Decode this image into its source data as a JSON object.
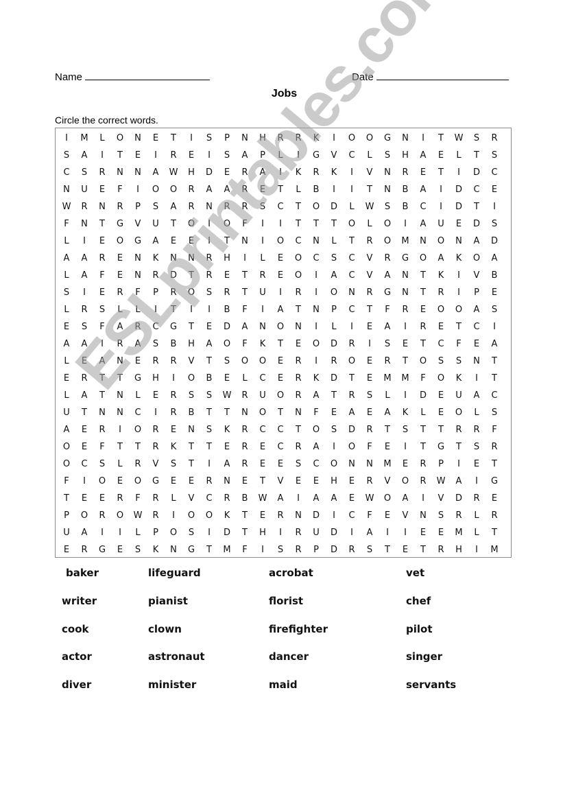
{
  "header": {
    "name_label": "Name",
    "date_label": "Date",
    "title": "Jobs",
    "instructions": "Circle the correct words."
  },
  "grid": [
    [
      "I",
      "M",
      "L",
      "O",
      "N",
      "E",
      "T",
      "I",
      "S",
      "P",
      "N",
      "H",
      "R",
      "R",
      "K",
      "I",
      "O",
      "O",
      "G",
      "N",
      "I",
      "T",
      "W",
      "S",
      "R"
    ],
    [
      "S",
      "A",
      "I",
      "T",
      "E",
      "I",
      "R",
      "E",
      "I",
      "S",
      "A",
      "P",
      "L",
      "I",
      "G",
      "V",
      "C",
      "L",
      "S",
      "H",
      "A",
      "E",
      "L",
      "T",
      "S"
    ],
    [
      "C",
      "S",
      "R",
      "N",
      "N",
      "A",
      "W",
      "H",
      "D",
      "E",
      "R",
      "A",
      "I",
      "K",
      "R",
      "K",
      "I",
      "V",
      "N",
      "R",
      "E",
      "T",
      "I",
      "D",
      "C"
    ],
    [
      "N",
      "U",
      "E",
      "F",
      "I",
      "O",
      "O",
      "R",
      "A",
      "A",
      "R",
      "E",
      "T",
      "L",
      "B",
      "I",
      "I",
      "T",
      "N",
      "B",
      "A",
      "I",
      "D",
      "C",
      "E"
    ],
    [
      "W",
      "R",
      "N",
      "R",
      "P",
      "S",
      "A",
      "R",
      "N",
      "R",
      "R",
      "S",
      "C",
      "T",
      "O",
      "D",
      "L",
      "W",
      "S",
      "B",
      "C",
      "I",
      "D",
      "T",
      "I"
    ],
    [
      "F",
      "N",
      "T",
      "G",
      "V",
      "U",
      "T",
      "O",
      "I",
      "O",
      "F",
      "I",
      "I",
      "T",
      "T",
      "T",
      "O",
      "L",
      "O",
      "I",
      "A",
      "U",
      "E",
      "D",
      "S"
    ],
    [
      "L",
      "I",
      "E",
      "O",
      "G",
      "A",
      "E",
      "E",
      "I",
      "T",
      "N",
      "I",
      "O",
      "C",
      "N",
      "L",
      "T",
      "R",
      "O",
      "M",
      "N",
      "O",
      "N",
      "A",
      "D"
    ],
    [
      "A",
      "A",
      "R",
      "E",
      "N",
      "K",
      "N",
      "N",
      "R",
      "H",
      "I",
      "L",
      "E",
      "O",
      "C",
      "S",
      "C",
      "V",
      "R",
      "G",
      "O",
      "A",
      "K",
      "O",
      "A"
    ],
    [
      "L",
      "A",
      "F",
      "E",
      "N",
      "R",
      "D",
      "T",
      "R",
      "E",
      "T",
      "R",
      "E",
      "O",
      "I",
      "A",
      "C",
      "V",
      "A",
      "N",
      "T",
      "K",
      "I",
      "V",
      "B"
    ],
    [
      "S",
      "I",
      "E",
      "R",
      "F",
      "P",
      "R",
      "O",
      "S",
      "R",
      "T",
      "U",
      "I",
      "R",
      "I",
      "O",
      "N",
      "R",
      "G",
      "N",
      "T",
      "R",
      "I",
      "P",
      "E"
    ],
    [
      "L",
      "R",
      "S",
      "L",
      "L",
      "I",
      "T",
      "I",
      "I",
      "B",
      "F",
      "I",
      "A",
      "T",
      "N",
      "P",
      "C",
      "T",
      "F",
      "R",
      "E",
      "O",
      "O",
      "A",
      "S"
    ],
    [
      "E",
      "S",
      "F",
      "A",
      "R",
      "C",
      "G",
      "T",
      "E",
      "D",
      "A",
      "N",
      "O",
      "N",
      "I",
      "L",
      "I",
      "E",
      "A",
      "I",
      "R",
      "E",
      "T",
      "C",
      "I"
    ],
    [
      "A",
      "A",
      "I",
      "R",
      "A",
      "S",
      "B",
      "H",
      "A",
      "O",
      "F",
      "K",
      "T",
      "E",
      "O",
      "D",
      "R",
      "I",
      "S",
      "E",
      "T",
      "C",
      "F",
      "E",
      "A"
    ],
    [
      "L",
      "E",
      "A",
      "N",
      "E",
      "R",
      "R",
      "V",
      "T",
      "S",
      "O",
      "O",
      "E",
      "R",
      "I",
      "R",
      "O",
      "E",
      "R",
      "T",
      "O",
      "S",
      "S",
      "N",
      "T"
    ],
    [
      "E",
      "R",
      "T",
      "T",
      "G",
      "H",
      "I",
      "O",
      "B",
      "E",
      "L",
      "C",
      "E",
      "R",
      "K",
      "D",
      "T",
      "E",
      "M",
      "M",
      "F",
      "O",
      "K",
      "I",
      "T"
    ],
    [
      "L",
      "A",
      "T",
      "N",
      "L",
      "E",
      "R",
      "S",
      "S",
      "W",
      "R",
      "U",
      "O",
      "R",
      "A",
      "T",
      "R",
      "S",
      "L",
      "I",
      "D",
      "E",
      "U",
      "A",
      "C"
    ],
    [
      "U",
      "T",
      "N",
      "N",
      "C",
      "I",
      "R",
      "B",
      "T",
      "T",
      "N",
      "O",
      "T",
      "N",
      "F",
      "E",
      "A",
      "E",
      "A",
      "K",
      "L",
      "E",
      "O",
      "L",
      "S"
    ],
    [
      "A",
      "E",
      "R",
      "I",
      "O",
      "R",
      "E",
      "N",
      "S",
      "K",
      "R",
      "C",
      "C",
      "T",
      "O",
      "S",
      "D",
      "R",
      "T",
      "S",
      "T",
      "T",
      "R",
      "R",
      "F"
    ],
    [
      "O",
      "E",
      "F",
      "T",
      "T",
      "R",
      "K",
      "T",
      "T",
      "E",
      "R",
      "E",
      "C",
      "R",
      "A",
      "I",
      "O",
      "F",
      "E",
      "I",
      "T",
      "G",
      "T",
      "S",
      "R"
    ],
    [
      "O",
      "C",
      "S",
      "L",
      "R",
      "V",
      "S",
      "T",
      "I",
      "A",
      "R",
      "E",
      "E",
      "S",
      "C",
      "O",
      "N",
      "N",
      "M",
      "E",
      "R",
      "P",
      "I",
      "E",
      "T"
    ],
    [
      "F",
      "I",
      "O",
      "E",
      "O",
      "G",
      "E",
      "E",
      "R",
      "N",
      "E",
      "T",
      "V",
      "E",
      "E",
      "H",
      "E",
      "R",
      "V",
      "O",
      "R",
      "W",
      "A",
      "I",
      "G"
    ],
    [
      "T",
      "E",
      "E",
      "R",
      "F",
      "R",
      "L",
      "V",
      "C",
      "R",
      "B",
      "W",
      "A",
      "I",
      "A",
      "A",
      "E",
      "W",
      "O",
      "A",
      "I",
      "V",
      "D",
      "R",
      "E"
    ],
    [
      "P",
      "O",
      "R",
      "O",
      "W",
      "R",
      "I",
      "O",
      "O",
      "K",
      "T",
      "E",
      "R",
      "N",
      "D",
      "I",
      "C",
      "F",
      "E",
      "V",
      "N",
      "S",
      "R",
      "L",
      "R"
    ],
    [
      "U",
      "A",
      "I",
      "I",
      "L",
      "P",
      "O",
      "S",
      "I",
      "D",
      "T",
      "H",
      "I",
      "R",
      "U",
      "D",
      "I",
      "A",
      "I",
      "I",
      "E",
      "E",
      "M",
      "L",
      "T"
    ],
    [
      "E",
      "R",
      "G",
      "E",
      "S",
      "K",
      "N",
      "G",
      "T",
      "M",
      "F",
      "I",
      "S",
      "R",
      "P",
      "D",
      "R",
      "S",
      "T",
      "E",
      "T",
      "R",
      "H",
      "I",
      "M"
    ]
  ],
  "word_list": [
    [
      "baker",
      "lifeguard",
      "acrobat",
      "vet"
    ],
    [
      "writer",
      "pianist",
      "florist",
      "chef"
    ],
    [
      "cook",
      "clown",
      "firefighter",
      "pilot"
    ],
    [
      "actor",
      "astronaut",
      "dancer",
      "singer"
    ],
    [
      "diver",
      "minister",
      "maid",
      "servants"
    ]
  ],
  "watermark": "ESLprintables.com"
}
